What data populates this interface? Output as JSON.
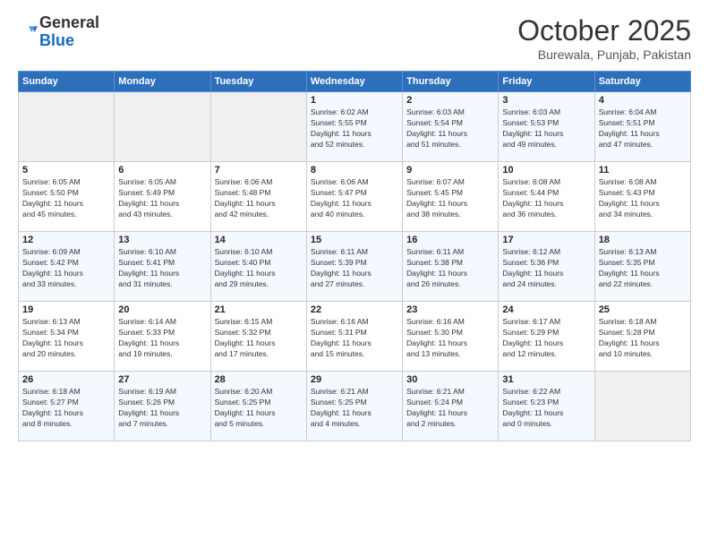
{
  "logo": {
    "general": "General",
    "blue": "Blue"
  },
  "header": {
    "month": "October 2025",
    "location": "Burewala, Punjab, Pakistan"
  },
  "weekdays": [
    "Sunday",
    "Monday",
    "Tuesday",
    "Wednesday",
    "Thursday",
    "Friday",
    "Saturday"
  ],
  "weeks": [
    [
      {
        "day": "",
        "detail": ""
      },
      {
        "day": "",
        "detail": ""
      },
      {
        "day": "",
        "detail": ""
      },
      {
        "day": "1",
        "detail": "Sunrise: 6:02 AM\nSunset: 5:55 PM\nDaylight: 11 hours\nand 52 minutes."
      },
      {
        "day": "2",
        "detail": "Sunrise: 6:03 AM\nSunset: 5:54 PM\nDaylight: 11 hours\nand 51 minutes."
      },
      {
        "day": "3",
        "detail": "Sunrise: 6:03 AM\nSunset: 5:53 PM\nDaylight: 11 hours\nand 49 minutes."
      },
      {
        "day": "4",
        "detail": "Sunrise: 6:04 AM\nSunset: 5:51 PM\nDaylight: 11 hours\nand 47 minutes."
      }
    ],
    [
      {
        "day": "5",
        "detail": "Sunrise: 6:05 AM\nSunset: 5:50 PM\nDaylight: 11 hours\nand 45 minutes."
      },
      {
        "day": "6",
        "detail": "Sunrise: 6:05 AM\nSunset: 5:49 PM\nDaylight: 11 hours\nand 43 minutes."
      },
      {
        "day": "7",
        "detail": "Sunrise: 6:06 AM\nSunset: 5:48 PM\nDaylight: 11 hours\nand 42 minutes."
      },
      {
        "day": "8",
        "detail": "Sunrise: 6:06 AM\nSunset: 5:47 PM\nDaylight: 11 hours\nand 40 minutes."
      },
      {
        "day": "9",
        "detail": "Sunrise: 6:07 AM\nSunset: 5:45 PM\nDaylight: 11 hours\nand 38 minutes."
      },
      {
        "day": "10",
        "detail": "Sunrise: 6:08 AM\nSunset: 5:44 PM\nDaylight: 11 hours\nand 36 minutes."
      },
      {
        "day": "11",
        "detail": "Sunrise: 6:08 AM\nSunset: 5:43 PM\nDaylight: 11 hours\nand 34 minutes."
      }
    ],
    [
      {
        "day": "12",
        "detail": "Sunrise: 6:09 AM\nSunset: 5:42 PM\nDaylight: 11 hours\nand 33 minutes."
      },
      {
        "day": "13",
        "detail": "Sunrise: 6:10 AM\nSunset: 5:41 PM\nDaylight: 11 hours\nand 31 minutes."
      },
      {
        "day": "14",
        "detail": "Sunrise: 6:10 AM\nSunset: 5:40 PM\nDaylight: 11 hours\nand 29 minutes."
      },
      {
        "day": "15",
        "detail": "Sunrise: 6:11 AM\nSunset: 5:39 PM\nDaylight: 11 hours\nand 27 minutes."
      },
      {
        "day": "16",
        "detail": "Sunrise: 6:11 AM\nSunset: 5:38 PM\nDaylight: 11 hours\nand 26 minutes."
      },
      {
        "day": "17",
        "detail": "Sunrise: 6:12 AM\nSunset: 5:36 PM\nDaylight: 11 hours\nand 24 minutes."
      },
      {
        "day": "18",
        "detail": "Sunrise: 6:13 AM\nSunset: 5:35 PM\nDaylight: 11 hours\nand 22 minutes."
      }
    ],
    [
      {
        "day": "19",
        "detail": "Sunrise: 6:13 AM\nSunset: 5:34 PM\nDaylight: 11 hours\nand 20 minutes."
      },
      {
        "day": "20",
        "detail": "Sunrise: 6:14 AM\nSunset: 5:33 PM\nDaylight: 11 hours\nand 19 minutes."
      },
      {
        "day": "21",
        "detail": "Sunrise: 6:15 AM\nSunset: 5:32 PM\nDaylight: 11 hours\nand 17 minutes."
      },
      {
        "day": "22",
        "detail": "Sunrise: 6:16 AM\nSunset: 5:31 PM\nDaylight: 11 hours\nand 15 minutes."
      },
      {
        "day": "23",
        "detail": "Sunrise: 6:16 AM\nSunset: 5:30 PM\nDaylight: 11 hours\nand 13 minutes."
      },
      {
        "day": "24",
        "detail": "Sunrise: 6:17 AM\nSunset: 5:29 PM\nDaylight: 11 hours\nand 12 minutes."
      },
      {
        "day": "25",
        "detail": "Sunrise: 6:18 AM\nSunset: 5:28 PM\nDaylight: 11 hours\nand 10 minutes."
      }
    ],
    [
      {
        "day": "26",
        "detail": "Sunrise: 6:18 AM\nSunset: 5:27 PM\nDaylight: 11 hours\nand 8 minutes."
      },
      {
        "day": "27",
        "detail": "Sunrise: 6:19 AM\nSunset: 5:26 PM\nDaylight: 11 hours\nand 7 minutes."
      },
      {
        "day": "28",
        "detail": "Sunrise: 6:20 AM\nSunset: 5:25 PM\nDaylight: 11 hours\nand 5 minutes."
      },
      {
        "day": "29",
        "detail": "Sunrise: 6:21 AM\nSunset: 5:25 PM\nDaylight: 11 hours\nand 4 minutes."
      },
      {
        "day": "30",
        "detail": "Sunrise: 6:21 AM\nSunset: 5:24 PM\nDaylight: 11 hours\nand 2 minutes."
      },
      {
        "day": "31",
        "detail": "Sunrise: 6:22 AM\nSunset: 5:23 PM\nDaylight: 11 hours\nand 0 minutes."
      },
      {
        "day": "",
        "detail": ""
      }
    ]
  ]
}
